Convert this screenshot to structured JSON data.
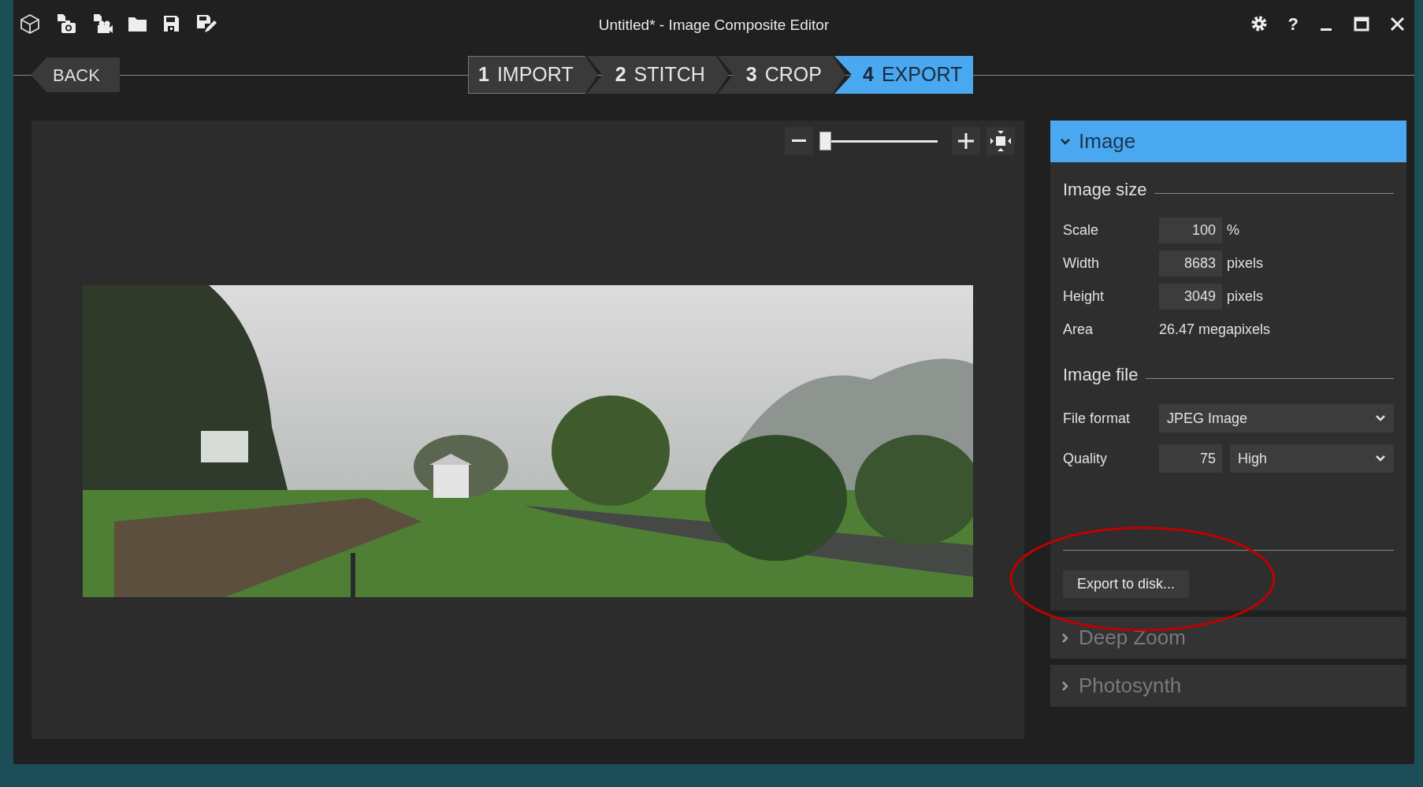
{
  "window": {
    "title": "Untitled* - Image Composite Editor",
    "help": "?"
  },
  "back_button": "BACK",
  "steps": [
    {
      "number": "1",
      "label": "IMPORT",
      "selected": false
    },
    {
      "number": "2",
      "label": "STITCH",
      "selected": false
    },
    {
      "number": "3",
      "label": "CROP",
      "selected": false
    },
    {
      "number": "4",
      "label": "EXPORT",
      "selected": true
    }
  ],
  "zoom": {
    "level": 0
  },
  "panel": {
    "sections": [
      {
        "title": "Image",
        "expanded": true
      },
      {
        "title": "Deep Zoom",
        "expanded": false
      },
      {
        "title": "Photosynth",
        "expanded": false
      }
    ],
    "image_size": {
      "heading": "Image size",
      "rows": [
        {
          "kind": "field",
          "label": "Scale",
          "value": "100",
          "unit": "%"
        },
        {
          "kind": "field",
          "label": "Width",
          "value": "8683",
          "unit": "pixels"
        },
        {
          "kind": "field",
          "label": "Height",
          "value": "3049",
          "unit": "pixels"
        },
        {
          "kind": "text",
          "label": "Area",
          "value": "26.47 megapixels"
        }
      ]
    },
    "image_file": {
      "heading": "Image file",
      "file_format": {
        "label": "File format",
        "value": "JPEG Image"
      },
      "quality": {
        "label": "Quality",
        "value": "75",
        "preset": "High"
      }
    },
    "export_button": "Export to disk..."
  }
}
